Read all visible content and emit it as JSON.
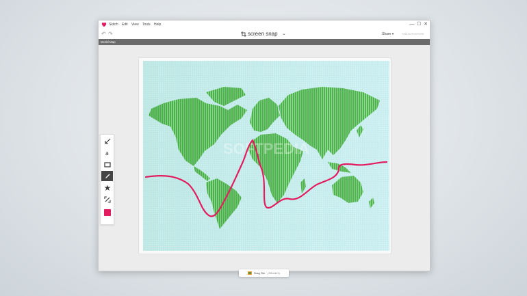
{
  "app": {
    "menu": [
      "Skitch",
      "Edit",
      "View",
      "Tools",
      "Help"
    ],
    "window_controls": [
      "—",
      "☐",
      "✕"
    ]
  },
  "toolbar": {
    "undo_label": "↶",
    "redo_label": "↷",
    "title": "screen snap",
    "title_chevron": "⌄",
    "share_label": "Share ▾",
    "add_evernote_label": "Add to Evernote"
  },
  "tab": {
    "title": "World Map"
  },
  "tools": [
    {
      "name": "arrow-tool",
      "icon": "arrow-icon"
    },
    {
      "name": "text-tool",
      "icon": "text-icon",
      "glyph": "a"
    },
    {
      "name": "rectangle-tool",
      "icon": "rectangle-icon"
    },
    {
      "name": "pen-tool",
      "icon": "pen-icon",
      "active": true
    },
    {
      "name": "stamp-tool",
      "icon": "stamp-icon"
    },
    {
      "name": "crop-tool",
      "icon": "crop-icon"
    },
    {
      "name": "color-picker",
      "icon": "color-swatch",
      "color": "#e31c5f"
    }
  ],
  "canvas": {
    "image": "world-map",
    "watermark": "SOFTPEDIA",
    "annotation_color": "#e31c5f",
    "land_color": "#4cb04c",
    "ocean_color": "#c9eef4"
  },
  "drag_bar": {
    "label": "Drag File",
    "size": "(391x411)"
  },
  "accent": "#e31c5f"
}
